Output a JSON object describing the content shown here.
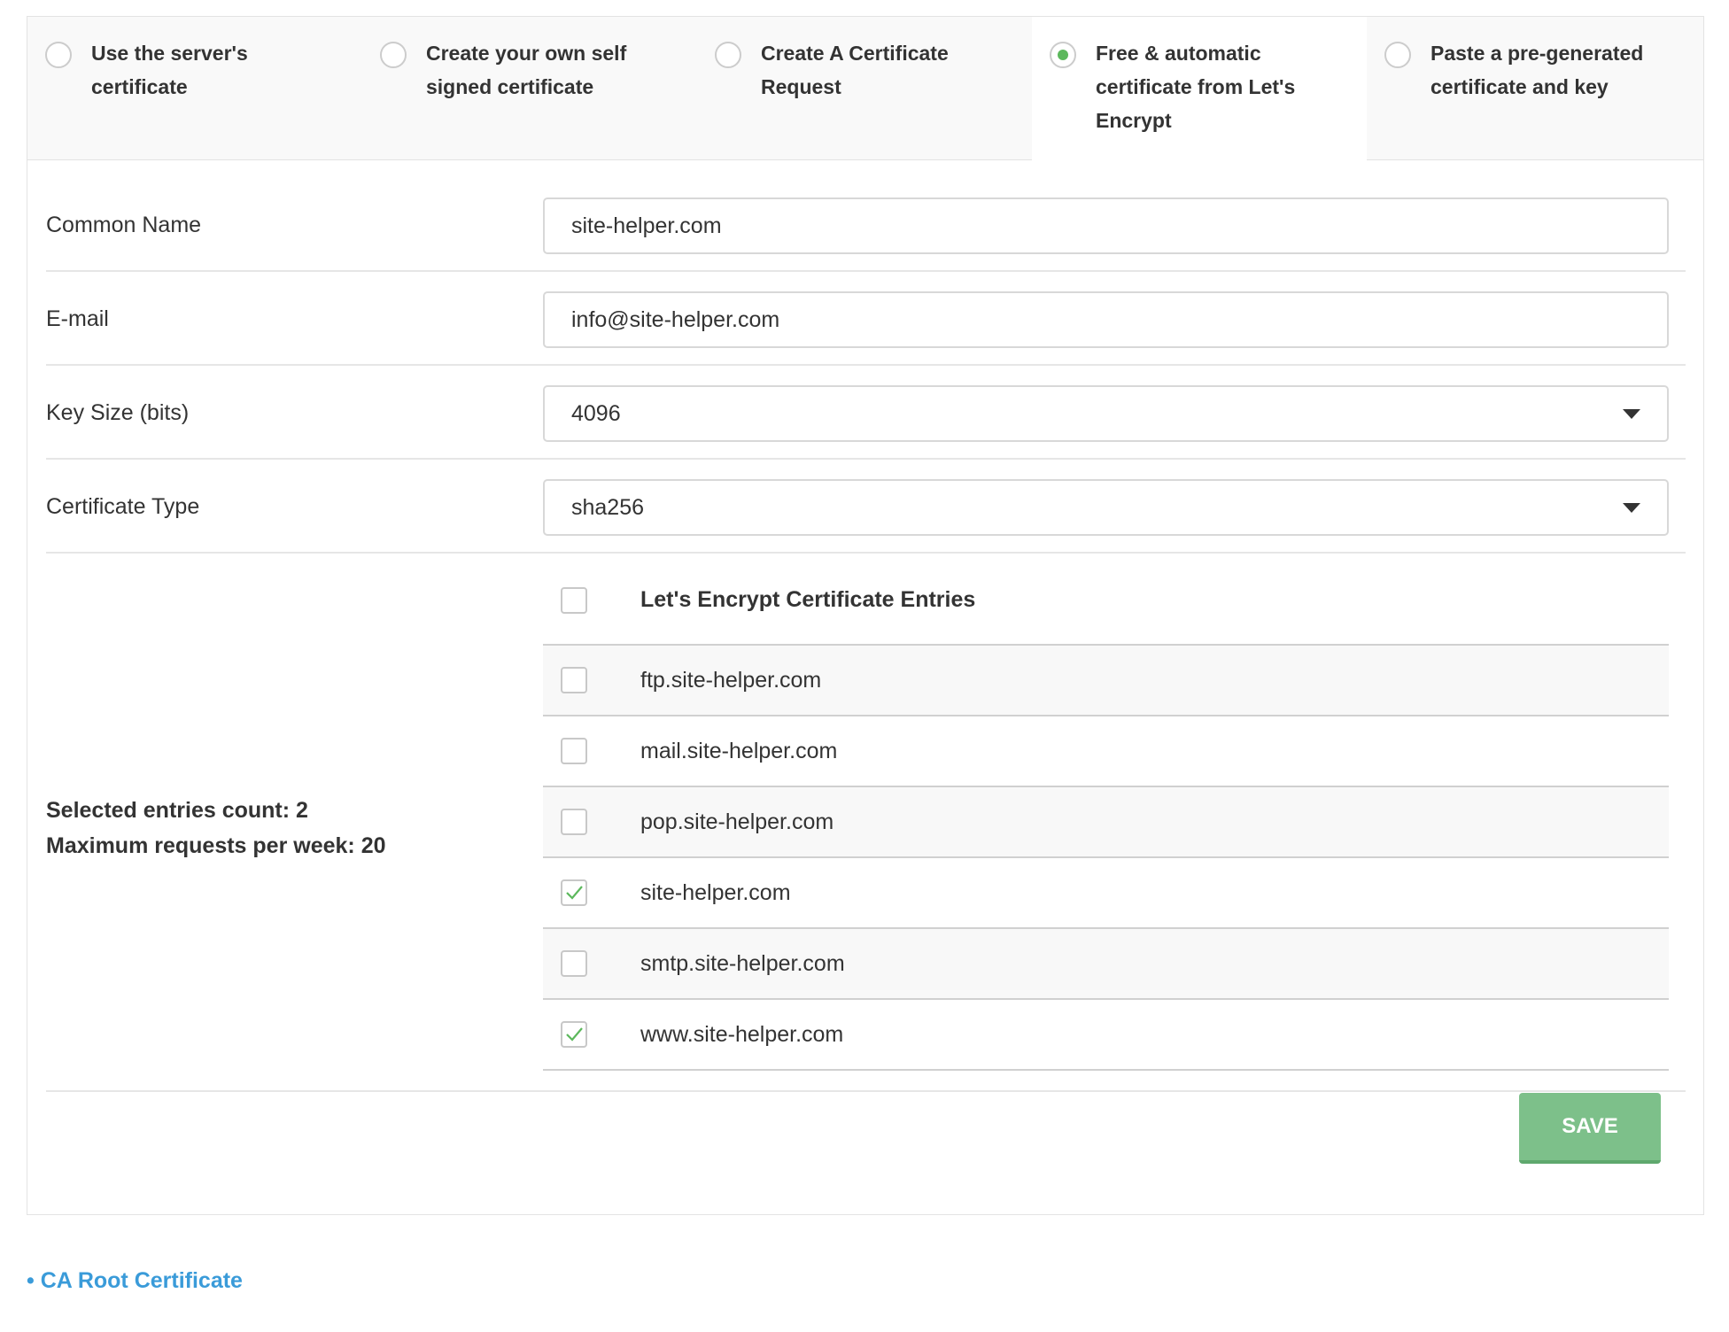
{
  "tabs": [
    {
      "label": "Use the server's certificate",
      "selected": false
    },
    {
      "label": "Create your own self signed certificate",
      "selected": false
    },
    {
      "label": "Create A Certificate Request",
      "selected": false
    },
    {
      "label": "Free & automatic certificate from Let's Encrypt",
      "selected": true
    },
    {
      "label": "Paste a pre-generated certificate and key",
      "selected": false
    }
  ],
  "form": {
    "common_name": {
      "label": "Common Name",
      "value": "site-helper.com"
    },
    "email": {
      "label": "E-mail",
      "value": "info@site-helper.com"
    },
    "key_size": {
      "label": "Key Size (bits)",
      "value": "4096"
    },
    "certificate_type": {
      "label": "Certificate Type",
      "value": "sha256"
    }
  },
  "summary": {
    "selected_count": "Selected entries count: 2",
    "max_requests": "Maximum requests per week: 20"
  },
  "entries": {
    "header": "Let's Encrypt Certificate Entries",
    "select_all_checked": false,
    "items": [
      {
        "name": "ftp.site-helper.com",
        "checked": false
      },
      {
        "name": "mail.site-helper.com",
        "checked": false
      },
      {
        "name": "pop.site-helper.com",
        "checked": false
      },
      {
        "name": "site-helper.com",
        "checked": true
      },
      {
        "name": "smtp.site-helper.com",
        "checked": false
      },
      {
        "name": "www.site-helper.com",
        "checked": true
      }
    ]
  },
  "save_label": "SAVE",
  "ca_root_link": "• CA Root Certificate",
  "colors": {
    "accent_green": "#5cb85c",
    "save_button": "#7dc08a",
    "link_blue": "#3a9bd9"
  }
}
